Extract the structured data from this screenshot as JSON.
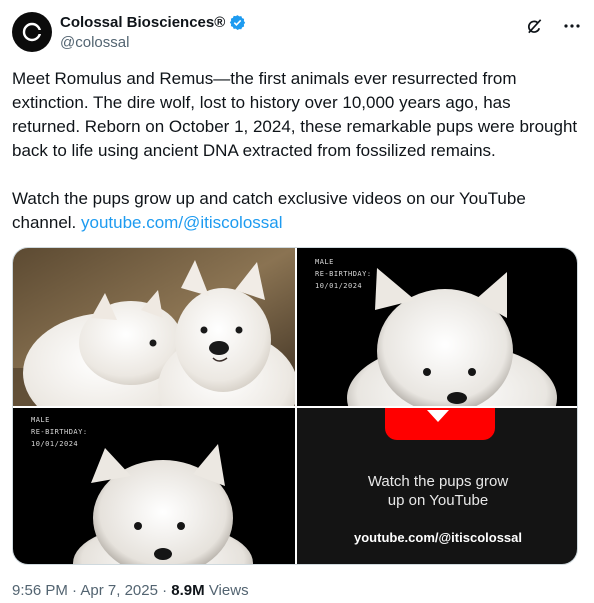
{
  "author": {
    "display_name": "Colossal Biosciences®",
    "handle": "@colossal",
    "avatar_icon": "colossal-logo-icon",
    "verified_icon": "verified-badge-icon",
    "verified_color": "#1d9bf0"
  },
  "actions": {
    "grok_icon": "grok-icon",
    "more_icon": "more-options-icon"
  },
  "tweet": {
    "paragraph1": "Meet Romulus and Remus—the first animals ever resurrected from extinction. The dire wolf, lost to history over 10,000 years ago, has returned. Reborn on October 1, 2024, these remarkable pups were brought back to life using ancient DNA extracted from fossilized remains.",
    "paragraph2_prefix": "Watch the pups grow up and catch exclusive videos on our YouTube channel. ",
    "link_text": "youtube.com/@itiscolossal",
    "link_color": "#1d9bf0"
  },
  "media": {
    "tile2_overlay": "MALE\nRE-BIRTHDAY:\n10/01/2024",
    "tile3_overlay": "MALE\nRE-BIRTHDAY:\n10/01/2024",
    "yt_caption_line1": "Watch the pups grow",
    "yt_caption_line2": "up on YouTube",
    "yt_url": "youtube.com/@itiscolossal",
    "yt_red": "#ff0000"
  },
  "meta": {
    "time": "9:56 PM",
    "separator": " · ",
    "date": "Apr 7, 2025",
    "views_count": "8.9M",
    "views_label": " Views"
  }
}
